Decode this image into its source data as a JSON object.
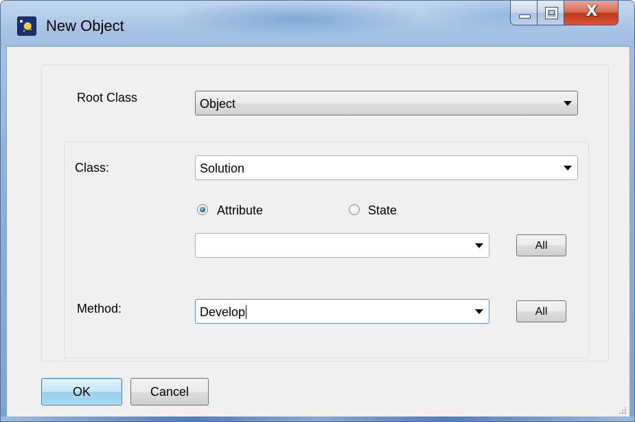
{
  "window": {
    "title": "New Object",
    "close_symbol": "X",
    "colors": {
      "titlebar": "#a9c5e4",
      "close": "#c2361b",
      "client": "#f0f0f0"
    }
  },
  "form": {
    "root_class": {
      "label": "Root Class",
      "value": "Object"
    },
    "class": {
      "label": "Class:",
      "value": "Solution"
    },
    "mode": {
      "options": [
        {
          "label": "Attribute",
          "checked": true
        },
        {
          "label": "State",
          "checked": false
        }
      ]
    },
    "attribute": {
      "value": "",
      "all_label": "All"
    },
    "method": {
      "label": "Method:",
      "value": "Develop",
      "all_label": "All"
    }
  },
  "buttons": {
    "ok": "OK",
    "cancel": "Cancel"
  }
}
